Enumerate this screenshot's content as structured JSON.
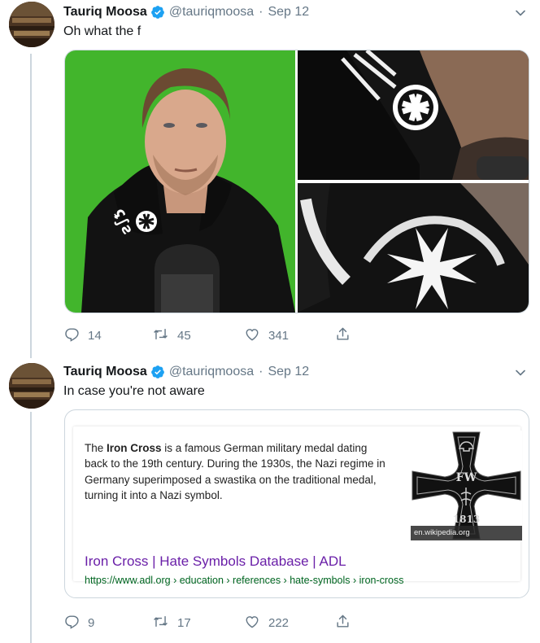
{
  "tweets": [
    {
      "author": "Tauriq Moosa",
      "handle": "@tauriqmoosa",
      "separator": "·",
      "date": "Sep 12",
      "text": "Oh what the f",
      "replies": "14",
      "retweets": "45",
      "likes": "341"
    },
    {
      "author": "Tauriq Moosa",
      "handle": "@tauriqmoosa",
      "separator": "·",
      "date": "Sep 12",
      "text": "In case you're not aware",
      "replies": "9",
      "retweets": "17",
      "likes": "222",
      "card": {
        "desc_prefix": "The ",
        "desc_bold": "Iron Cross",
        "desc_rest": " is a famous German military medal dating back to the 19th century. During the 1930s, the Nazi regime in Germany superimposed a swastika on the traditional medal, turning it into a Nazi symbol.",
        "image_caption": "en.wikipedia.org",
        "cross_letters": "FW",
        "cross_year": "1813",
        "title": "Iron Cross | Hate Symbols Database | ADL",
        "url": "https://www.adl.org › education › references › hate-symbols › iron-cross"
      }
    }
  ],
  "colors": {
    "text_primary": "#14171a",
    "text_secondary": "#657786",
    "verified_blue": "#1da1f2",
    "border": "#ccd6dd",
    "green_screen": "#42b52c",
    "link_purple": "#6a1fa8",
    "url_green": "#006621"
  },
  "icons": [
    "verified-icon",
    "caret-down-icon",
    "reply-icon",
    "retweet-icon",
    "like-icon",
    "share-icon"
  ]
}
